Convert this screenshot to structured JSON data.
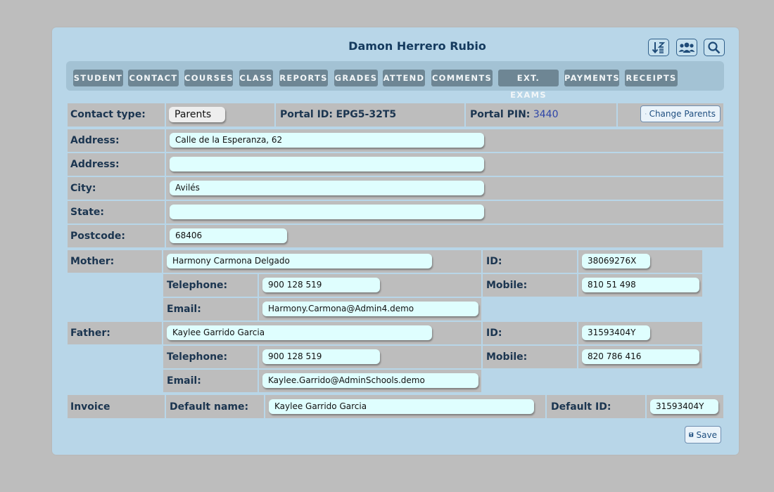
{
  "header": {
    "title": "Damon Herrero Rubio",
    "icons": [
      "sort-icon",
      "group-icon",
      "search-icon"
    ]
  },
  "tabs": [
    "STUDENT",
    "CONTACT",
    "COURSES",
    "CLASS",
    "REPORTS",
    "GRADES",
    "ATTEND",
    "COMMENTS",
    "EXT. EXAMS",
    "PAYMENTS",
    "RECEIPTS"
  ],
  "contact": {
    "type_label": "Contact type:",
    "type_value": "Parents",
    "portal_id_label": "Portal ID:",
    "portal_id_value": "EPG5-32T5",
    "portal_pin_label": "Portal PIN:",
    "portal_pin_value": "3440",
    "change_parents": "Change Parents"
  },
  "address": {
    "address_label": "Address:",
    "address1": "Calle de la Esperanza, 62",
    "address2": "",
    "city_label": "City:",
    "city": "Avilés",
    "state_label": "State:",
    "state": "",
    "postcode_label": "Postcode:",
    "postcode": "68406"
  },
  "mother": {
    "label": "Mother:",
    "name": "Harmony Carmona Delgado",
    "id_label": "ID:",
    "id": "38069276X",
    "telephone_label": "Telephone:",
    "telephone": "900 128 519",
    "mobile_label": "Mobile:",
    "mobile": "810 51 498",
    "email_label": "Email:",
    "email": "Harmony.Carmona@Admin4.demo"
  },
  "father": {
    "label": "Father:",
    "name": "Kaylee Garrido Garcia",
    "id_label": "ID:",
    "id": "31593404Y",
    "telephone_label": "Telephone:",
    "telephone": "900 128 519",
    "mobile_label": "Mobile:",
    "mobile": "820 786 416",
    "email_label": "Email:",
    "email": "Kaylee.Garrido@AdminSchools.demo"
  },
  "invoice": {
    "label": "Invoice",
    "default_name_label": "Default name:",
    "default_name": "Kaylee Garrido Garcia",
    "default_id_label": "Default ID:",
    "default_id": "31593404Y"
  },
  "save_label": "Save"
}
